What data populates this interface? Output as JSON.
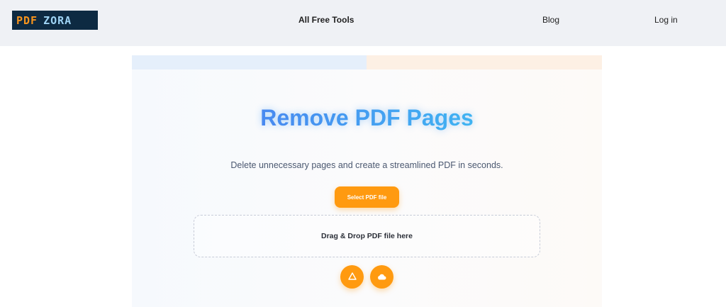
{
  "header": {
    "logo": {
      "part1": "PDF",
      "part2": "ZORA"
    },
    "nav": {
      "all_free_tools": "All Free Tools",
      "blog": "Blog",
      "login": "Log in"
    }
  },
  "main": {
    "title": "Remove PDF Pages",
    "subtitle": "Delete unnecessary pages and create a streamlined PDF in seconds.",
    "select_button": "Select PDF file",
    "dropzone_text": "Drag & Drop PDF file here",
    "upload_sources": [
      {
        "icon": "google-drive-icon"
      },
      {
        "icon": "cloud-icon"
      }
    ]
  },
  "colors": {
    "accent": "#ff9a10",
    "title_blue": "#4a8df4",
    "header_bg": "#eff1f5",
    "logo_bg": "#0d2a42"
  }
}
